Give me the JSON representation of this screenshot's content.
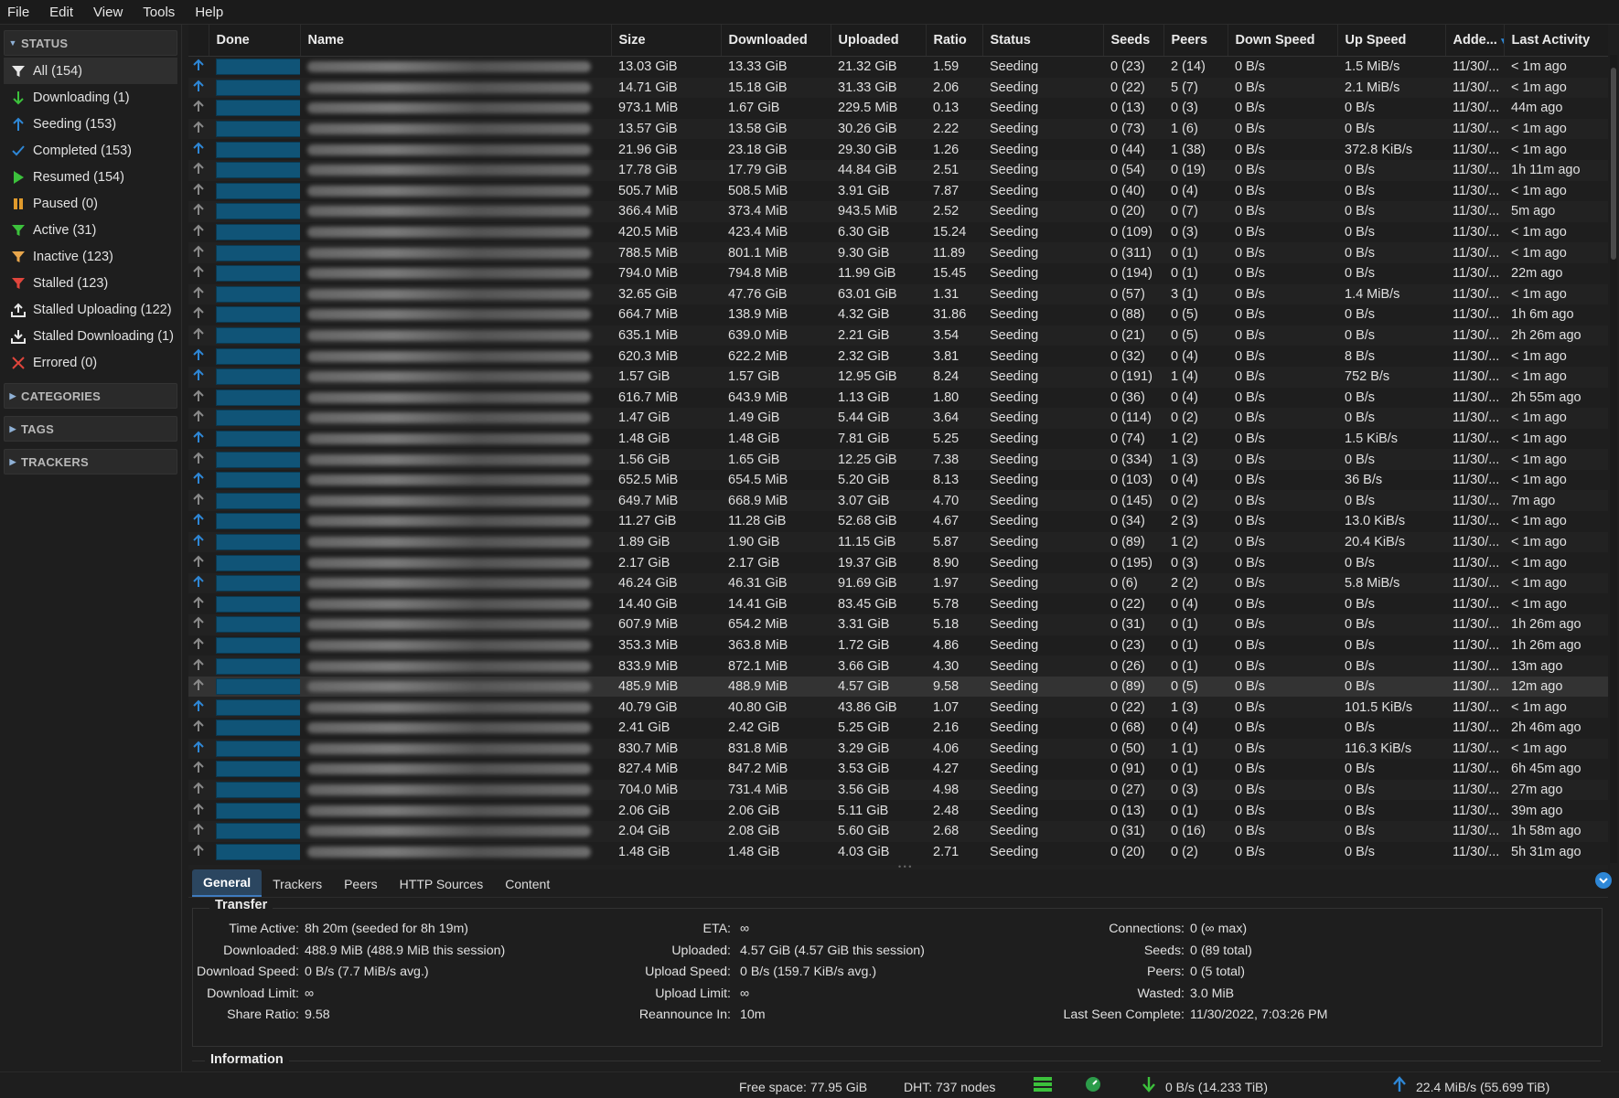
{
  "menu": [
    "File",
    "Edit",
    "View",
    "Tools",
    "Help"
  ],
  "sidebar": {
    "status_header": "STATUS",
    "status_items": [
      {
        "label": "All (154)",
        "icon": "filter-icon"
      },
      {
        "label": "Downloading (1)",
        "icon": "download-arrow-icon"
      },
      {
        "label": "Seeding (153)",
        "icon": "upload-arrow-icon"
      },
      {
        "label": "Completed (153)",
        "icon": "checkmark-icon"
      },
      {
        "label": "Resumed (154)",
        "icon": "play-icon"
      },
      {
        "label": "Paused (0)",
        "icon": "pause-icon"
      },
      {
        "label": "Active (31)",
        "icon": "filter-green-icon"
      },
      {
        "label": "Inactive (123)",
        "icon": "filter-orange-icon"
      },
      {
        "label": "Stalled (123)",
        "icon": "filter-red-icon"
      },
      {
        "label": "Stalled Uploading (122)",
        "icon": "stalled-upload-icon"
      },
      {
        "label": "Stalled Downloading (1)",
        "icon": "stalled-download-icon"
      },
      {
        "label": "Errored (0)",
        "icon": "error-x-icon"
      }
    ],
    "categories_header": "CATEGORIES",
    "tags_header": "TAGS",
    "trackers_header": "TRACKERS"
  },
  "table": {
    "columns": [
      "Done",
      "Name",
      "Size",
      "Downloaded",
      "Uploaded",
      "Ratio",
      "Status",
      "Seeds",
      "Peers",
      "Down Speed",
      "Up Speed",
      "Adde...",
      "Last Activity"
    ],
    "rows": [
      {
        "active": true,
        "size": "13.03 GiB",
        "dl": "13.33 GiB",
        "ul": "21.32 GiB",
        "ratio": "1.59",
        "rc": "w",
        "status": "Seeding",
        "seeds": "0 (23)",
        "peers": "2 (14)",
        "down": "0 B/s",
        "up": "1.5 MiB/s",
        "added": "11/30/...",
        "last": "< 1m ago"
      },
      {
        "active": true,
        "size": "14.71 GiB",
        "dl": "15.18 GiB",
        "ul": "31.33 GiB",
        "ratio": "2.06",
        "rc": "g",
        "status": "Seeding",
        "seeds": "0 (22)",
        "peers": "5 (7)",
        "down": "0 B/s",
        "up": "2.1 MiB/s",
        "added": "11/30/...",
        "last": "< 1m ago"
      },
      {
        "active": false,
        "size": "973.1 MiB",
        "dl": "1.67 GiB",
        "ul": "229.5 MiB",
        "ratio": "0.13",
        "rc": "d",
        "status": "Seeding",
        "seeds": "0 (13)",
        "peers": "0 (3)",
        "down": "0 B/s",
        "up": "0 B/s",
        "added": "11/30/...",
        "last": "44m ago"
      },
      {
        "active": false,
        "size": "13.57 GiB",
        "dl": "13.58 GiB",
        "ul": "30.26 GiB",
        "ratio": "2.22",
        "rc": "g",
        "status": "Seeding",
        "seeds": "0 (73)",
        "peers": "1 (6)",
        "down": "0 B/s",
        "up": "0 B/s",
        "added": "11/30/...",
        "last": "< 1m ago"
      },
      {
        "active": true,
        "size": "21.96 GiB",
        "dl": "23.18 GiB",
        "ul": "29.30 GiB",
        "ratio": "1.26",
        "rc": "w",
        "status": "Seeding",
        "seeds": "0 (44)",
        "peers": "1 (38)",
        "down": "0 B/s",
        "up": "372.8 KiB/s",
        "added": "11/30/...",
        "last": "< 1m ago"
      },
      {
        "active": false,
        "size": "17.78 GiB",
        "dl": "17.79 GiB",
        "ul": "44.84 GiB",
        "ratio": "2.51",
        "rc": "g",
        "status": "Seeding",
        "seeds": "0 (54)",
        "peers": "0 (19)",
        "down": "0 B/s",
        "up": "0 B/s",
        "added": "11/30/...",
        "last": "1h 11m ago"
      },
      {
        "active": false,
        "size": "505.7 MiB",
        "dl": "508.5 MiB",
        "ul": "3.91 GiB",
        "ratio": "7.87",
        "rc": "g",
        "status": "Seeding",
        "seeds": "0 (40)",
        "peers": "0 (4)",
        "down": "0 B/s",
        "up": "0 B/s",
        "added": "11/30/...",
        "last": "< 1m ago"
      },
      {
        "active": false,
        "size": "366.4 MiB",
        "dl": "373.4 MiB",
        "ul": "943.5 MiB",
        "ratio": "2.52",
        "rc": "g",
        "status": "Seeding",
        "seeds": "0 (20)",
        "peers": "0 (7)",
        "down": "0 B/s",
        "up": "0 B/s",
        "added": "11/30/...",
        "last": "5m ago"
      },
      {
        "active": false,
        "size": "420.5 MiB",
        "dl": "423.4 MiB",
        "ul": "6.30 GiB",
        "ratio": "15.24",
        "rc": "b",
        "status": "Seeding",
        "seeds": "0 (109)",
        "peers": "0 (3)",
        "down": "0 B/s",
        "up": "0 B/s",
        "added": "11/30/...",
        "last": "< 1m ago"
      },
      {
        "active": false,
        "size": "788.5 MiB",
        "dl": "801.1 MiB",
        "ul": "9.30 GiB",
        "ratio": "11.89",
        "rc": "b",
        "status": "Seeding",
        "seeds": "0 (311)",
        "peers": "0 (1)",
        "down": "0 B/s",
        "up": "0 B/s",
        "added": "11/30/...",
        "last": "< 1m ago"
      },
      {
        "active": false,
        "size": "794.0 MiB",
        "dl": "794.8 MiB",
        "ul": "11.99 GiB",
        "ratio": "15.45",
        "rc": "b",
        "status": "Seeding",
        "seeds": "0 (194)",
        "peers": "0 (1)",
        "down": "0 B/s",
        "up": "0 B/s",
        "added": "11/30/...",
        "last": "22m ago"
      },
      {
        "active": false,
        "size": "32.65 GiB",
        "dl": "47.76 GiB",
        "ul": "63.01 GiB",
        "ratio": "1.31",
        "rc": "w",
        "status": "Seeding",
        "seeds": "0 (57)",
        "peers": "3 (1)",
        "down": "0 B/s",
        "up": "1.4 MiB/s",
        "added": "11/30/...",
        "last": "< 1m ago"
      },
      {
        "active": false,
        "size": "664.7 MiB",
        "dl": "138.9 MiB",
        "ul": "4.32 GiB",
        "ratio": "31.86",
        "rc": "p",
        "status": "Seeding",
        "seeds": "0 (88)",
        "peers": "0 (5)",
        "down": "0 B/s",
        "up": "0 B/s",
        "added": "11/30/...",
        "last": "1h 6m ago"
      },
      {
        "active": false,
        "size": "635.1 MiB",
        "dl": "639.0 MiB",
        "ul": "2.21 GiB",
        "ratio": "3.54",
        "rc": "g",
        "status": "Seeding",
        "seeds": "0 (21)",
        "peers": "0 (5)",
        "down": "0 B/s",
        "up": "0 B/s",
        "added": "11/30/...",
        "last": "2h 26m ago"
      },
      {
        "active": true,
        "size": "620.3 MiB",
        "dl": "622.2 MiB",
        "ul": "2.32 GiB",
        "ratio": "3.81",
        "rc": "g",
        "status": "Seeding",
        "seeds": "0 (32)",
        "peers": "0 (4)",
        "down": "0 B/s",
        "up": "8 B/s",
        "added": "11/30/...",
        "last": "< 1m ago"
      },
      {
        "active": true,
        "size": "1.57 GiB",
        "dl": "1.57 GiB",
        "ul": "12.95 GiB",
        "ratio": "8.24",
        "rc": "g",
        "status": "Seeding",
        "seeds": "0 (191)",
        "peers": "1 (4)",
        "down": "0 B/s",
        "up": "752 B/s",
        "added": "11/30/...",
        "last": "< 1m ago"
      },
      {
        "active": false,
        "size": "616.7 MiB",
        "dl": "643.9 MiB",
        "ul": "1.13 GiB",
        "ratio": "1.80",
        "rc": "w",
        "status": "Seeding",
        "seeds": "0 (36)",
        "peers": "0 (4)",
        "down": "0 B/s",
        "up": "0 B/s",
        "added": "11/30/...",
        "last": "2h 55m ago"
      },
      {
        "active": false,
        "size": "1.47 GiB",
        "dl": "1.49 GiB",
        "ul": "5.44 GiB",
        "ratio": "3.64",
        "rc": "g",
        "status": "Seeding",
        "seeds": "0 (114)",
        "peers": "0 (2)",
        "down": "0 B/s",
        "up": "0 B/s",
        "added": "11/30/...",
        "last": "< 1m ago"
      },
      {
        "active": true,
        "size": "1.48 GiB",
        "dl": "1.48 GiB",
        "ul": "7.81 GiB",
        "ratio": "5.25",
        "rc": "g",
        "status": "Seeding",
        "seeds": "0 (74)",
        "peers": "1 (2)",
        "down": "0 B/s",
        "up": "1.5 KiB/s",
        "added": "11/30/...",
        "last": "< 1m ago"
      },
      {
        "active": false,
        "size": "1.56 GiB",
        "dl": "1.65 GiB",
        "ul": "12.25 GiB",
        "ratio": "7.38",
        "rc": "g",
        "status": "Seeding",
        "seeds": "0 (334)",
        "peers": "1 (3)",
        "down": "0 B/s",
        "up": "0 B/s",
        "added": "11/30/...",
        "last": "< 1m ago"
      },
      {
        "active": true,
        "size": "652.5 MiB",
        "dl": "654.5 MiB",
        "ul": "5.20 GiB",
        "ratio": "8.13",
        "rc": "g",
        "status": "Seeding",
        "seeds": "0 (103)",
        "peers": "0 (4)",
        "down": "0 B/s",
        "up": "36 B/s",
        "added": "11/30/...",
        "last": "< 1m ago"
      },
      {
        "active": false,
        "size": "649.7 MiB",
        "dl": "668.9 MiB",
        "ul": "3.07 GiB",
        "ratio": "4.70",
        "rc": "g",
        "status": "Seeding",
        "seeds": "0 (145)",
        "peers": "0 (2)",
        "down": "0 B/s",
        "up": "0 B/s",
        "added": "11/30/...",
        "last": "7m ago"
      },
      {
        "active": true,
        "size": "11.27 GiB",
        "dl": "11.28 GiB",
        "ul": "52.68 GiB",
        "ratio": "4.67",
        "rc": "g",
        "status": "Seeding",
        "seeds": "0 (34)",
        "peers": "2 (3)",
        "down": "0 B/s",
        "up": "13.0 KiB/s",
        "added": "11/30/...",
        "last": "< 1m ago"
      },
      {
        "active": true,
        "size": "1.89 GiB",
        "dl": "1.90 GiB",
        "ul": "11.15 GiB",
        "ratio": "5.87",
        "rc": "g",
        "status": "Seeding",
        "seeds": "0 (89)",
        "peers": "1 (2)",
        "down": "0 B/s",
        "up": "20.4 KiB/s",
        "added": "11/30/...",
        "last": "< 1m ago"
      },
      {
        "active": false,
        "size": "2.17 GiB",
        "dl": "2.17 GiB",
        "ul": "19.37 GiB",
        "ratio": "8.90",
        "rc": "g",
        "status": "Seeding",
        "seeds": "0 (195)",
        "peers": "0 (3)",
        "down": "0 B/s",
        "up": "0 B/s",
        "added": "11/30/...",
        "last": "< 1m ago"
      },
      {
        "active": true,
        "size": "46.24 GiB",
        "dl": "46.31 GiB",
        "ul": "91.69 GiB",
        "ratio": "1.97",
        "rc": "w",
        "status": "Seeding",
        "seeds": "0 (6)",
        "peers": "2 (2)",
        "down": "0 B/s",
        "up": "5.8 MiB/s",
        "added": "11/30/...",
        "last": "< 1m ago"
      },
      {
        "active": false,
        "size": "14.40 GiB",
        "dl": "14.41 GiB",
        "ul": "83.45 GiB",
        "ratio": "5.78",
        "rc": "g",
        "status": "Seeding",
        "seeds": "0 (22)",
        "peers": "0 (4)",
        "down": "0 B/s",
        "up": "0 B/s",
        "added": "11/30/...",
        "last": "< 1m ago"
      },
      {
        "active": false,
        "size": "607.9 MiB",
        "dl": "654.2 MiB",
        "ul": "3.31 GiB",
        "ratio": "5.18",
        "rc": "g",
        "status": "Seeding",
        "seeds": "0 (31)",
        "peers": "0 (1)",
        "down": "0 B/s",
        "up": "0 B/s",
        "added": "11/30/...",
        "last": "1h 26m ago"
      },
      {
        "active": false,
        "size": "353.3 MiB",
        "dl": "363.8 MiB",
        "ul": "1.72 GiB",
        "ratio": "4.86",
        "rc": "g",
        "status": "Seeding",
        "seeds": "0 (23)",
        "peers": "0 (1)",
        "down": "0 B/s",
        "up": "0 B/s",
        "added": "11/30/...",
        "last": "1h 26m ago"
      },
      {
        "active": false,
        "size": "833.9 MiB",
        "dl": "872.1 MiB",
        "ul": "3.66 GiB",
        "ratio": "4.30",
        "rc": "g",
        "status": "Seeding",
        "seeds": "0 (26)",
        "peers": "0 (1)",
        "down": "0 B/s",
        "up": "0 B/s",
        "added": "11/30/...",
        "last": "13m ago"
      },
      {
        "active": false,
        "sel": true,
        "size": "485.9 MiB",
        "dl": "488.9 MiB",
        "ul": "4.57 GiB",
        "ratio": "9.58",
        "rc": "g",
        "status": "Seeding",
        "seeds": "0 (89)",
        "peers": "0 (5)",
        "down": "0 B/s",
        "up": "0 B/s",
        "added": "11/30/...",
        "last": "12m ago"
      },
      {
        "active": true,
        "size": "40.79 GiB",
        "dl": "40.80 GiB",
        "ul": "43.86 GiB",
        "ratio": "1.07",
        "rc": "w",
        "status": "Seeding",
        "seeds": "0 (22)",
        "peers": "1 (3)",
        "down": "0 B/s",
        "up": "101.5 KiB/s",
        "added": "11/30/...",
        "last": "< 1m ago"
      },
      {
        "active": false,
        "size": "2.41 GiB",
        "dl": "2.42 GiB",
        "ul": "5.25 GiB",
        "ratio": "2.16",
        "rc": "g",
        "status": "Seeding",
        "seeds": "0 (68)",
        "peers": "0 (4)",
        "down": "0 B/s",
        "up": "0 B/s",
        "added": "11/30/...",
        "last": "2h 46m ago"
      },
      {
        "active": true,
        "size": "830.7 MiB",
        "dl": "831.8 MiB",
        "ul": "3.29 GiB",
        "ratio": "4.06",
        "rc": "g",
        "status": "Seeding",
        "seeds": "0 (50)",
        "peers": "1 (1)",
        "down": "0 B/s",
        "up": "116.3 KiB/s",
        "added": "11/30/...",
        "last": "< 1m ago"
      },
      {
        "active": false,
        "size": "827.4 MiB",
        "dl": "847.2 MiB",
        "ul": "3.53 GiB",
        "ratio": "4.27",
        "rc": "g",
        "status": "Seeding",
        "seeds": "0 (91)",
        "peers": "0 (1)",
        "down": "0 B/s",
        "up": "0 B/s",
        "added": "11/30/...",
        "last": "6h 45m ago"
      },
      {
        "active": false,
        "size": "704.0 MiB",
        "dl": "731.4 MiB",
        "ul": "3.56 GiB",
        "ratio": "4.98",
        "rc": "g",
        "status": "Seeding",
        "seeds": "0 (27)",
        "peers": "0 (3)",
        "down": "0 B/s",
        "up": "0 B/s",
        "added": "11/30/...",
        "last": "27m ago"
      },
      {
        "active": false,
        "size": "2.06 GiB",
        "dl": "2.06 GiB",
        "ul": "5.11 GiB",
        "ratio": "2.48",
        "rc": "g",
        "status": "Seeding",
        "seeds": "0 (13)",
        "peers": "0 (1)",
        "down": "0 B/s",
        "up": "0 B/s",
        "added": "11/30/...",
        "last": "39m ago"
      },
      {
        "active": false,
        "size": "2.04 GiB",
        "dl": "2.08 GiB",
        "ul": "5.60 GiB",
        "ratio": "2.68",
        "rc": "g",
        "status": "Seeding",
        "seeds": "0 (31)",
        "peers": "0 (16)",
        "down": "0 B/s",
        "up": "0 B/s",
        "added": "11/30/...",
        "last": "1h 58m ago"
      },
      {
        "active": false,
        "size": "1.48 GiB",
        "dl": "1.48 GiB",
        "ul": "4.03 GiB",
        "ratio": "2.71",
        "rc": "g",
        "status": "Seeding",
        "seeds": "0 (20)",
        "peers": "0 (2)",
        "down": "0 B/s",
        "up": "0 B/s",
        "added": "11/30/...",
        "last": "5h 31m ago"
      }
    ]
  },
  "details": {
    "tabs": [
      "General",
      "Trackers",
      "Peers",
      "HTTP Sources",
      "Content"
    ],
    "transfer_title": "Transfer",
    "information_title": "Information",
    "col1": [
      {
        "k": "Time Active:",
        "v": "8h 20m (seeded for 8h 19m)"
      },
      {
        "k": "Downloaded:",
        "v": "488.9 MiB (488.9 MiB this session)"
      },
      {
        "k": "Download Speed:",
        "v": "0 B/s (7.7 MiB/s avg.)"
      },
      {
        "k": "Download Limit:",
        "v": "∞"
      },
      {
        "k": "Share Ratio:",
        "v": "9.58"
      }
    ],
    "col2": [
      {
        "k": "ETA:",
        "v": "∞"
      },
      {
        "k": "Uploaded:",
        "v": "4.57 GiB (4.57 GiB this session)"
      },
      {
        "k": "Upload Speed:",
        "v": "0 B/s (159.7 KiB/s avg.)"
      },
      {
        "k": "Upload Limit:",
        "v": "∞"
      },
      {
        "k": "Reannounce In:",
        "v": "10m"
      }
    ],
    "col3": [
      {
        "k": "Connections:",
        "v": "0 (∞ max)"
      },
      {
        "k": "Seeds:",
        "v": "0 (89 total)"
      },
      {
        "k": "Peers:",
        "v": "0 (5 total)"
      },
      {
        "k": "Wasted:",
        "v": "3.0 MiB"
      },
      {
        "k": "Last Seen Complete:",
        "v": "11/30/2022, 7:03:26 PM"
      }
    ]
  },
  "statusbar": {
    "free_space": "Free space: 77.95 GiB",
    "dht": "DHT: 737 nodes",
    "down": "0 B/s (14.233 TiB)",
    "up": "22.4 MiB/s (55.699 TiB)"
  },
  "colors": {
    "progress": "#105477",
    "ratio_green": "#3dd13d",
    "ratio_blue": "#4aa3ff",
    "ratio_purple": "#b05de0",
    "arrow_active": "#2e87d6",
    "arrow_idle": "#8a8a8a"
  }
}
